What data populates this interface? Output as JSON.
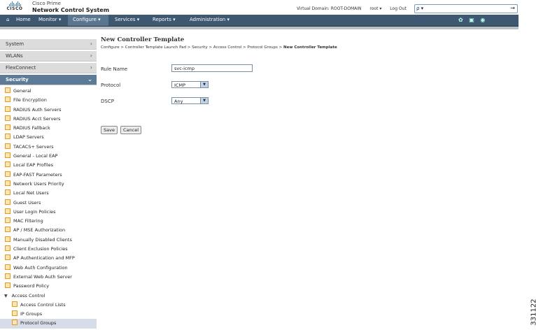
{
  "app": {
    "logo_text": "CISCO",
    "title_line1": "Cisco Prime",
    "title_line2": "Network Control System"
  },
  "header": {
    "virtual_domain": "Virtual Domain: ROOT-DOMAIN",
    "user": "root ▾",
    "logout": "Log Out",
    "search_scope": "ρ ▾",
    "search_go": "→"
  },
  "nav": {
    "home": "Home",
    "monitor": "Monitor ▾",
    "configure": "Configure ▾",
    "services": "Services ▾",
    "reports": "Reports ▾",
    "administration": "Administration ▾"
  },
  "sidebar": {
    "categories": [
      "System",
      "WLANs",
      "FlexConnect",
      "Security"
    ],
    "security_items": [
      "General",
      "File Encryption",
      "RADIUS Auth Servers",
      "RADIUS Acct Servers",
      "RADIUS Fallback",
      "LDAP Servers",
      "TACACS+ Servers",
      "General - Local EAP",
      "Local EAP Profiles",
      "EAP-FAST Parameters",
      "Network Users Priority",
      "Local Net Users",
      "Guest Users",
      "User Login Policies",
      "MAC Filtering",
      "AP / MSE Authorization",
      "Manually Disabled Clients",
      "Client Exclusion Policies",
      "AP Authentication and MFP",
      "Web Auth Configuration",
      "External Web Auth Server",
      "Password Policy"
    ],
    "access_control_label": "Access Control",
    "access_control_items": [
      "Access Control Lists",
      "IP Groups",
      "Protocol Groups"
    ]
  },
  "page": {
    "title": "New Controller Template",
    "breadcrumb": "Configure > Controller Template Launch Pad > Security > Access Control > Protocol Groups > ",
    "breadcrumb_current": "New Controller Template"
  },
  "form": {
    "rule_name_label": "Rule Name",
    "rule_name_value": "svc-icmp",
    "protocol_label": "Protocol",
    "protocol_value": "ICMP",
    "dscp_label": "DSCP",
    "dscp_value": "Any",
    "save_label": "Save",
    "cancel_label": "Cancel"
  },
  "figure_number": "331122",
  "colors": {
    "navbar": "#3f5872",
    "sidebar_active": "#5d7a97",
    "selected_item": "#d6dde8"
  }
}
